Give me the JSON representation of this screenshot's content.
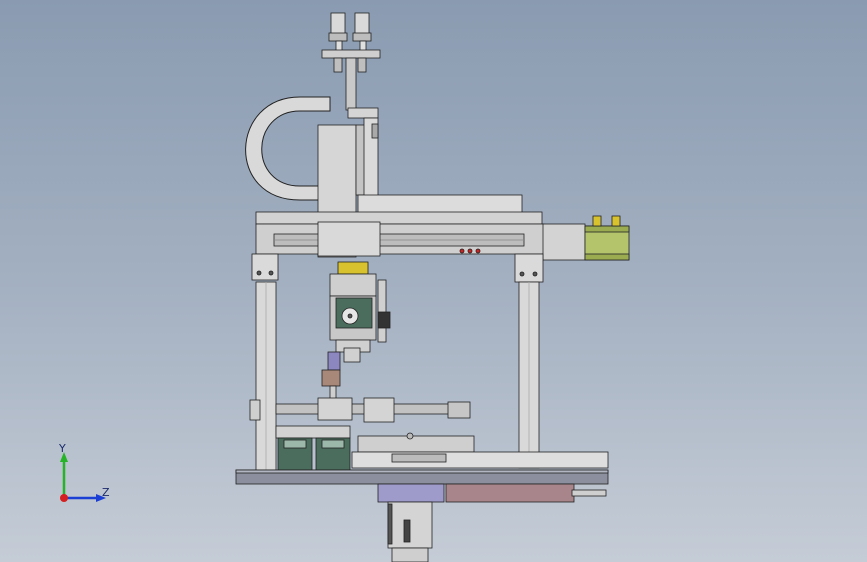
{
  "viewport": {
    "background_top": "#8a9bb1",
    "background_bottom": "#c5ccd6"
  },
  "model": {
    "frame_color": "#d4d4d4",
    "shadow_color": "#8c8c8c",
    "motor_color": "#b3c46a",
    "coupling_color": "#d8c32e",
    "block_color": "#4a6d5d",
    "cylinder_color": "#a8858a",
    "base_plate_color": "#8c8f9e",
    "cradle_color": "#9e9ac9"
  },
  "triad": {
    "y_label": "Y",
    "z_label": "Z",
    "y_color": "#27b327",
    "z_color": "#1b3fd4",
    "origin_color": "#d42020"
  }
}
